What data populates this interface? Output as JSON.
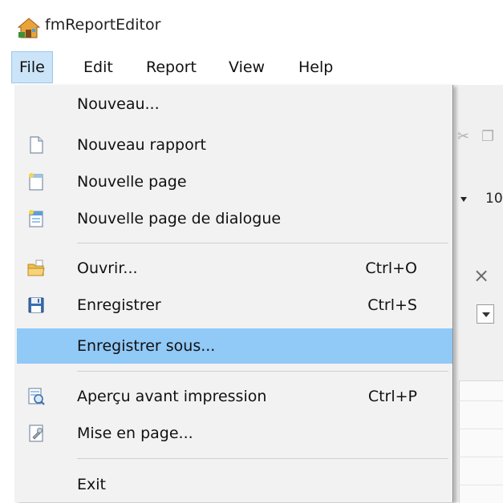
{
  "window": {
    "title": "fmReportEditor",
    "app_icon": "house-icon"
  },
  "menubar": {
    "items": [
      {
        "label": "File",
        "active": true
      },
      {
        "label": "Edit"
      },
      {
        "label": "Report"
      },
      {
        "label": "View"
      },
      {
        "label": "Help"
      }
    ]
  },
  "file_menu": {
    "items": [
      {
        "label": "Nouveau...",
        "icon": "",
        "shortcut": ""
      },
      {
        "label": "Nouveau rapport",
        "icon": "new-document-icon",
        "shortcut": ""
      },
      {
        "label": "Nouvelle page",
        "icon": "new-page-icon",
        "shortcut": ""
      },
      {
        "label": "Nouvelle page de dialogue",
        "icon": "new-dialog-page-icon",
        "shortcut": ""
      },
      {
        "label": "Ouvrir...",
        "icon": "open-folder-icon",
        "shortcut": "Ctrl+O"
      },
      {
        "label": "Enregistrer",
        "icon": "save-floppy-icon",
        "shortcut": "Ctrl+S"
      },
      {
        "label": "Enregistrer sous...",
        "icon": "",
        "shortcut": "",
        "highlighted": true
      },
      {
        "label": "Aperçu avant impression",
        "icon": "print-preview-icon",
        "shortcut": "Ctrl+P"
      },
      {
        "label": "Mise en page...",
        "icon": "page-setup-icon",
        "shortcut": ""
      },
      {
        "label": "Exit",
        "icon": "",
        "shortcut": ""
      }
    ]
  },
  "background": {
    "font_size_value": "10",
    "close_glyph": "×"
  },
  "colors": {
    "menu_background": "#f2f2f2",
    "highlight": "#91c9f7",
    "active_menubar": "#cce4f7"
  }
}
